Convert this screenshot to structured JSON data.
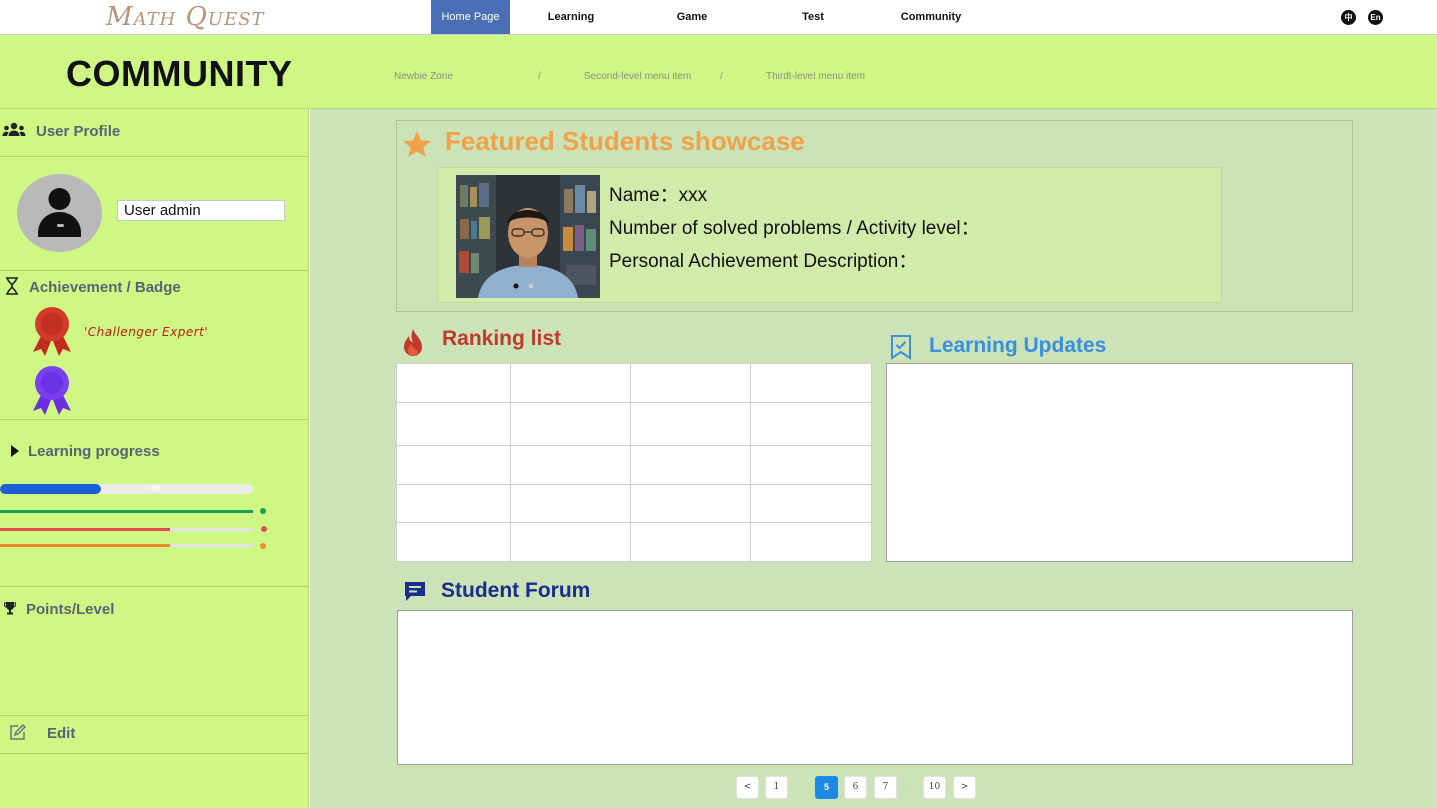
{
  "app": {
    "logo": "Math Quest"
  },
  "nav": {
    "items": [
      {
        "label": "Home Page"
      },
      {
        "label": "Learning"
      },
      {
        "label": "Game"
      },
      {
        "label": "Test"
      },
      {
        "label": "Community"
      }
    ],
    "active": "Home Page",
    "lang": [
      "中",
      "En"
    ]
  },
  "header": {
    "title": "COMMUNITY",
    "breadcrumb": [
      "Newbie Zone",
      "/",
      "Second-level menu item",
      "/",
      "Thirdt-level menu item"
    ]
  },
  "sidebar": {
    "profile": {
      "heading": "User Profile",
      "username": "User admin"
    },
    "achievements": {
      "heading": "Achievement / Badge",
      "badges": [
        {
          "label": "'Challenger Expert'",
          "color": "#d43a2a"
        },
        {
          "label": "",
          "color": "#7b3ff2"
        }
      ]
    },
    "progress": {
      "heading": "Learning progress",
      "main": {
        "value": 60,
        "label": "60",
        "color": "#1a5fd6"
      },
      "bars": [
        {
          "value": 100,
          "color": "#16a05a"
        },
        {
          "value": 67,
          "color": "#e14d4d"
        },
        {
          "value": 67,
          "color": "#f08a2e"
        }
      ]
    },
    "points": {
      "heading": "Points/Level"
    },
    "edit": {
      "heading": "Edit"
    }
  },
  "main": {
    "featured": {
      "title": "Featured Students showcase",
      "name": "Name：xxx",
      "solved": "Number of solved problems / Activity level：",
      "achievement": "Personal Achievement Description："
    },
    "ranking": {
      "title": "Ranking list",
      "rows": 5,
      "cols": 4
    },
    "updates": {
      "title": "Learning Updates"
    },
    "forum": {
      "title": "Student Forum"
    },
    "pagination": {
      "prev": "<",
      "next": ">",
      "pages": [
        "1",
        "5",
        "6",
        "7",
        "10"
      ],
      "current": "5"
    }
  },
  "colors": {
    "lime": "#cff783",
    "main_bg": "#cce3b8",
    "featured_orange": "#f0a24a",
    "ranking_red": "#c0392b",
    "updates_blue": "#3a8fdc",
    "forum_navy": "#1a2d8c",
    "accent_blue": "#1e88e5"
  }
}
